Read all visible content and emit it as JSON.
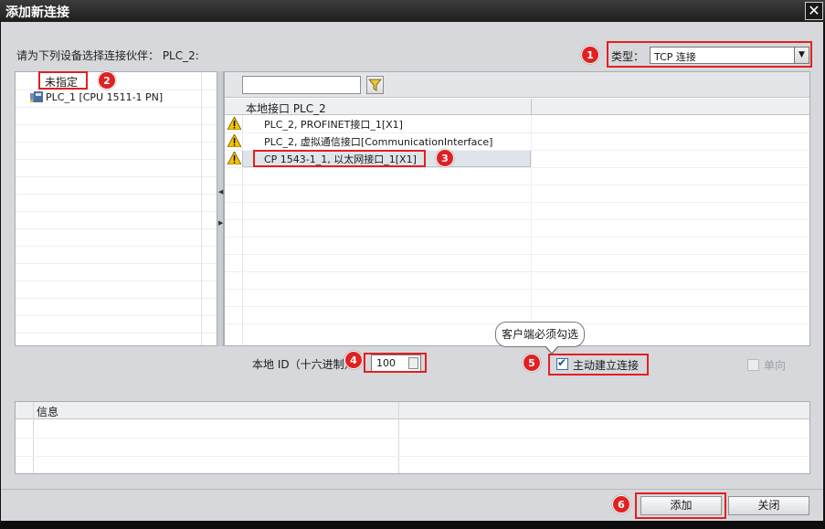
{
  "window": {
    "title": "添加新连接",
    "close_glyph": "✕"
  },
  "prompt": "请为下列设备选择连接伙伴： PLC_2:",
  "connection_type": {
    "label": "类型：",
    "value": "TCP 连接"
  },
  "left_tree": {
    "unassigned_label": "未指定",
    "device_label": "PLC_1 [CPU 1511-1 PN]",
    "device_icon": "plc-device-icon"
  },
  "right_table": {
    "filter_placeholder": "",
    "filter_icon": "funnel-filter-icon",
    "column_header": "本地接口 PLC_2",
    "rows": [
      {
        "label": "PLC_2, PROFINET接口_1[X1]",
        "icon": "warning-icon"
      },
      {
        "label": "PLC_2, 虚拟通信接口[CommunicationInterface]",
        "icon": "warning-icon"
      },
      {
        "label": "CP 1543-1_1, 以太网接口_1[X1]",
        "icon": "warning-icon"
      }
    ]
  },
  "local_id": {
    "label": "本地 ID（十六进制）：",
    "value": "100"
  },
  "active_connection": {
    "label": "主动建立连接",
    "checked": true
  },
  "one_way": {
    "label": "单向",
    "checked": false,
    "enabled": false
  },
  "callout": {
    "text": "客户端必须勾选"
  },
  "info_panel": {
    "header": "信息"
  },
  "buttons": {
    "add": "添加",
    "close": "关闭"
  },
  "markers": [
    "1",
    "2",
    "3",
    "4",
    "5",
    "6"
  ],
  "colors": {
    "marker": "#e02121",
    "titlebar": "#1e1e1e",
    "dialog_bg": "#d6d8dc",
    "warning": "#f5c400"
  }
}
